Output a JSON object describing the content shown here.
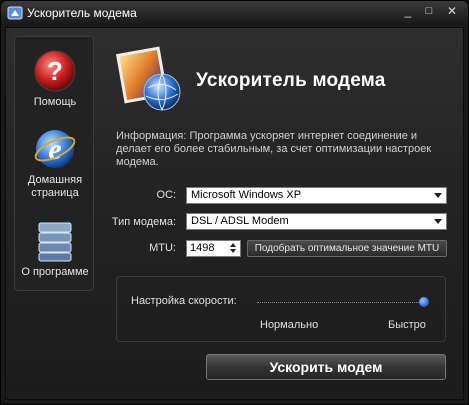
{
  "window": {
    "title": "Ускоритель модема",
    "controls": {
      "minimize": "_",
      "maximize": "□",
      "close": "✕"
    }
  },
  "sidebar": {
    "items": [
      {
        "label": "Помощь",
        "icon": "help-icon"
      },
      {
        "label": "Домашняя страница",
        "icon": "internet-explorer-icon"
      },
      {
        "label": "О программе",
        "icon": "server-stack-icon"
      }
    ]
  },
  "main": {
    "title": "Ускоритель модема",
    "header_icon": "network-globe-icon",
    "info": "Информация: Программа ускоряет интернет соединение и делает его более стабильным, за счет оптимизации настроек модема."
  },
  "form": {
    "os_label": "ОС:",
    "os_value": "Microsoft Windows XP",
    "modem_label": "Тип модема:",
    "modem_value": "DSL / ADSL Modem",
    "mtu_label": "MTU:",
    "mtu_value": "1498",
    "mtu_button": "Подобрать оптимальное значение MTU"
  },
  "speed": {
    "label": "Настройка скорости:",
    "min_label": "Нормально",
    "max_label": "Быстро",
    "level": 1.0
  },
  "actions": {
    "boost_button": "Ускорить модем"
  },
  "colors": {
    "background": "#1c1c1c",
    "accent_blue": "#1c5fd0",
    "help_red": "#c81e1e"
  }
}
